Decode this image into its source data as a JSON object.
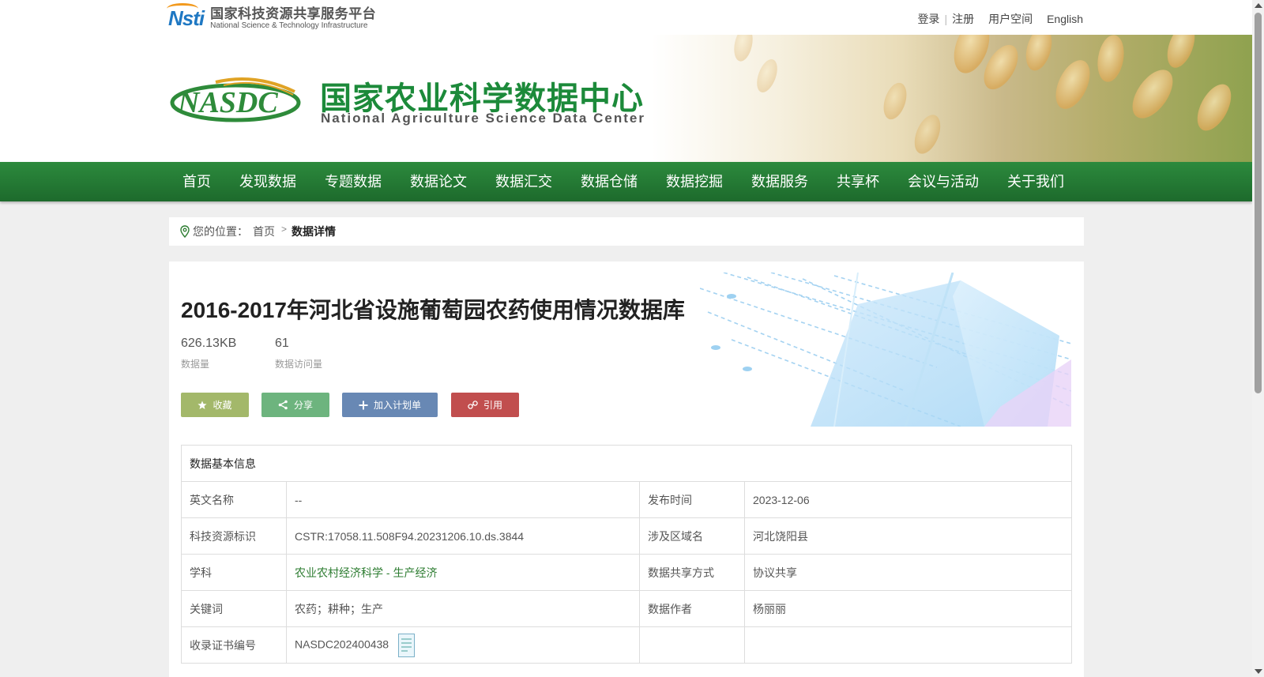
{
  "topbar": {
    "nsti_mark": "Nsti",
    "nsti_cn": "国家科技资源共享服务平台",
    "nsti_en": "National Science & Technology Infrastructure",
    "links": {
      "login": "登录",
      "register": "注册",
      "user_space": "用户空间",
      "english": "English"
    }
  },
  "banner": {
    "center_cn": "国家农业科学数据中心",
    "center_en": "National Agriculture Science Data Center",
    "logo_text": "NASDC"
  },
  "nav": {
    "items": [
      "首页",
      "发现数据",
      "专题数据",
      "数据论文",
      "数据汇交",
      "数据仓储",
      "数据挖掘",
      "数据服务",
      "共享杯",
      "会议与活动",
      "关于我们"
    ]
  },
  "breadcrumb": {
    "prefix": "您的位置：",
    "home": "首页",
    "current": "数据详情"
  },
  "dataset": {
    "title": "2016-2017年河北省设施葡萄园农药使用情况数据库",
    "size_value": "626.13KB",
    "size_label": "数据量",
    "visits_value": "61",
    "visits_label": "数据访问量"
  },
  "buttons": {
    "favorite": "收藏",
    "share": "分享",
    "add_plan": "加入计划单",
    "cite": "引用"
  },
  "info": {
    "header": "数据基本信息",
    "rows": [
      {
        "k1": "英文名称",
        "v1": "--",
        "k2": "发布时间",
        "v2": "2023-12-06"
      },
      {
        "k1": "科技资源标识",
        "v1": "CSTR:17058.11.508F94.20231206.10.ds.3844",
        "k2": "涉及区域名",
        "v2": "河北饶阳县"
      },
      {
        "k1": "学科",
        "v1": "农业农村经济科学 - 生产经济",
        "k2": "数据共享方式",
        "v2": "协议共享"
      },
      {
        "k1": "关键词",
        "v1": "农药；耕种；生产",
        "k2": "数据作者",
        "v2": "杨丽丽"
      },
      {
        "k1": "收录证书编号",
        "v1": "NASDC202400438",
        "k2": "",
        "v2": ""
      }
    ]
  },
  "colors": {
    "nav_green": "#1d6a2c",
    "title_green": "#1c8a3a",
    "fav": "#a3b86a",
    "share": "#6db47e",
    "plan": "#6888b4",
    "cite": "#c14e4e"
  }
}
